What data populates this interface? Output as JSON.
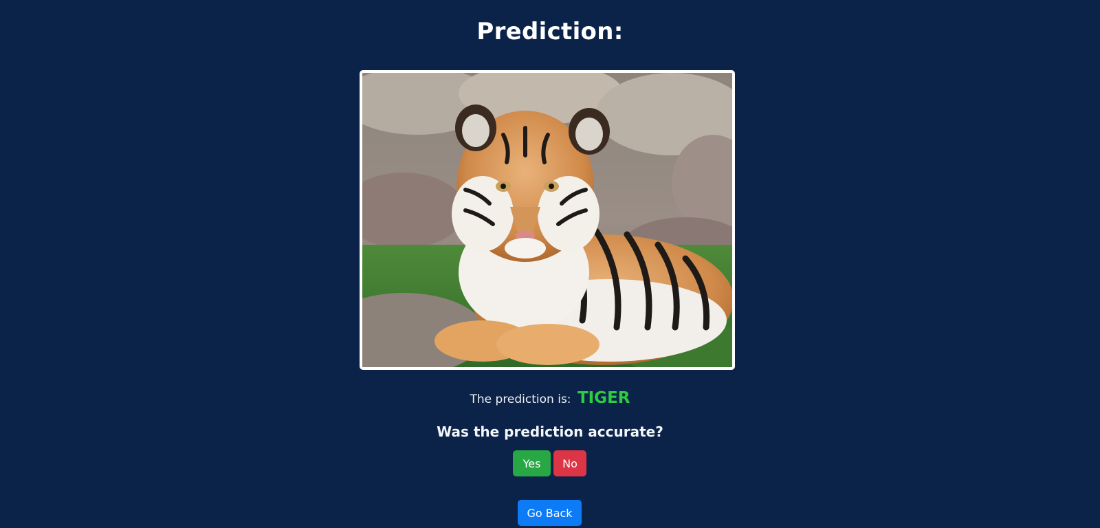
{
  "header": {
    "title": "Prediction:"
  },
  "image": {
    "subject": "tiger-cub-photo"
  },
  "result": {
    "label": "The prediction is:",
    "value": "TIGER",
    "value_color": "#2ecc40"
  },
  "feedback": {
    "question": "Was the prediction accurate?",
    "yes_label": "Yes",
    "no_label": "No",
    "yes_color": "#28a745",
    "no_color": "#dc3545"
  },
  "navigation": {
    "back_label": "Go Back",
    "back_color": "#0d7bf6"
  },
  "theme": {
    "background": "#0b2349"
  }
}
